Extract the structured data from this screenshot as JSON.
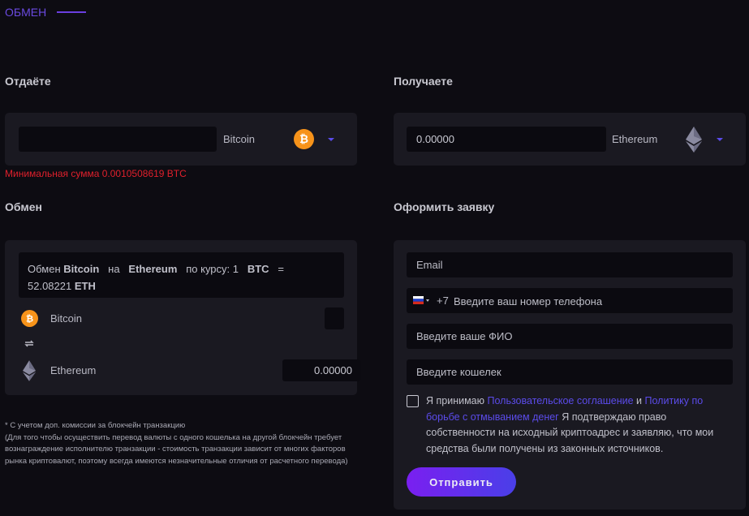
{
  "header": {
    "title": "ОБМЕН"
  },
  "give": {
    "heading": "Отдаёте",
    "amount": "",
    "currency": "Bitcoin",
    "error": "Минимальная сумма 0.0010508619 BTC"
  },
  "receive": {
    "heading": "Получаете",
    "amount": "0.00000",
    "currency": "Ethereum"
  },
  "exchange": {
    "heading": "Обмен",
    "rate": {
      "prefix": "Обмен",
      "from": "Bitcoin",
      "on": "на",
      "to": "Ethereum",
      "by_rate": "по курсу: 1",
      "from_code": "BTC",
      "eq": "=",
      "value": "52.08221",
      "to_code": "ETH"
    },
    "from_name": "Bitcoin",
    "from_amount": "",
    "to_name": "Ethereum",
    "to_amount": "0.00000"
  },
  "footnote": {
    "line1": "* С учетом доп. комиссии за блокчейн транзакцию",
    "line2": "(Для того чтобы осуществить перевод валюты с одного кошелька на другой блокчейн требует",
    "line3": "вознаграждение исполнителю транзакции - стоимость транзакции зависит от многих факторов",
    "line4": "рынка криптовалют, поэтому всегда имеются незначительные отличия от расчетного перевода)"
  },
  "order": {
    "heading": "Оформить заявку",
    "email_placeholder": "Email",
    "phone_code": "+7",
    "phone_placeholder": "Введите ваш номер телефона",
    "name_placeholder": "Введите ваше ФИО",
    "wallet_placeholder": "Введите кошелек",
    "agree_text": "Я принимаю",
    "agree_link1": "Пользовательское соглашение",
    "agree_and": "и",
    "agree_link2": "Политику по борьбе с отмыванием денег",
    "agree_rest": "Я подтверждаю право собственности на исходный криптоадрес и заявляю, что мои средства были получены из законных источников.",
    "submit_label": "Отправить"
  },
  "colors": {
    "accent": "#5b4bea",
    "error": "#e0202c",
    "bitcoin": "#f7931a"
  }
}
